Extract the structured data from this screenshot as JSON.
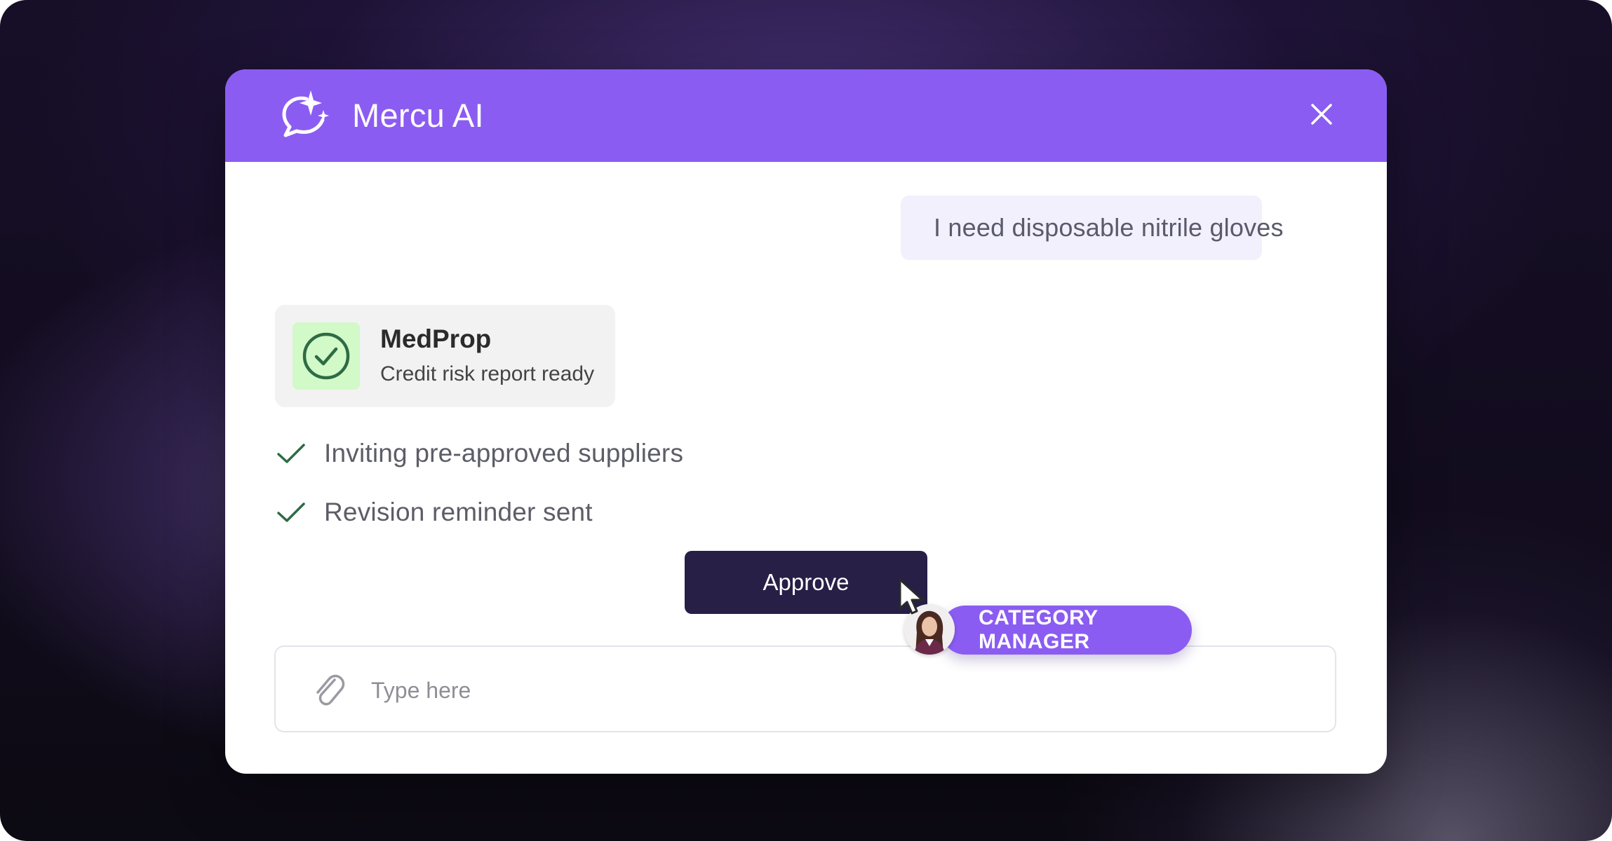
{
  "app": {
    "title": "Mercu AI"
  },
  "conversation": {
    "user_message": "I need disposable nitrile gloves",
    "supplier_card": {
      "name": "MedProp",
      "status": "Credit risk report ready"
    },
    "steps": [
      {
        "label": "Inviting pre-approved suppliers",
        "icon": "check-icon"
      },
      {
        "label": "Revision reminder sent",
        "icon": "check-icon"
      }
    ],
    "approve_label": "Approve"
  },
  "collaborator": {
    "role": "CATEGORY MANAGER"
  },
  "composer": {
    "placeholder": "Type here",
    "value": ""
  },
  "colors": {
    "accent": "#8b5cf2",
    "button_dark": "#271f46",
    "success_green": "#2e6b45",
    "success_bg": "#d2f9c8",
    "user_bubble": "#f3f0fd"
  },
  "icons": {
    "logo": "chat-sparkle-icon",
    "close": "close-icon",
    "attach": "paperclip-icon",
    "status": "check-circle-icon",
    "pointer": "cursor-arrow-icon"
  }
}
